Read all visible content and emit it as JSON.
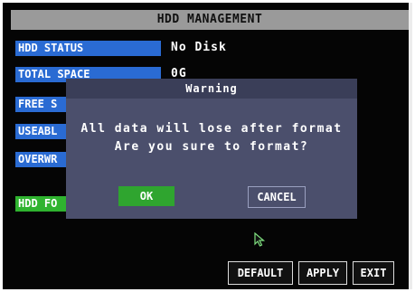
{
  "window": {
    "title": "HDD MANAGEMENT"
  },
  "fields": [
    {
      "label": "HDD STATUS",
      "value": "No Disk"
    },
    {
      "label": "TOTAL SPACE",
      "value": "0G"
    },
    {
      "label": "FREE S",
      "value": ""
    },
    {
      "label": "USEABL",
      "value": ""
    },
    {
      "label": "OVERWR",
      "value": ""
    }
  ],
  "format_button": {
    "label": "HDD FO"
  },
  "buttons": {
    "default": "DEFAULT",
    "apply": "APPLY",
    "exit": "EXIT"
  },
  "dialog": {
    "title": "Warning",
    "message_line1": "All data will lose after format",
    "message_line2": "Are you sure to format?",
    "ok": "OK",
    "cancel": "CANCEL"
  },
  "colors": {
    "label_bg": "#2a6bd3",
    "green": "#2fb32f",
    "dialog_bg": "#4b4f6c",
    "title_bar": "#9a9a9a"
  }
}
